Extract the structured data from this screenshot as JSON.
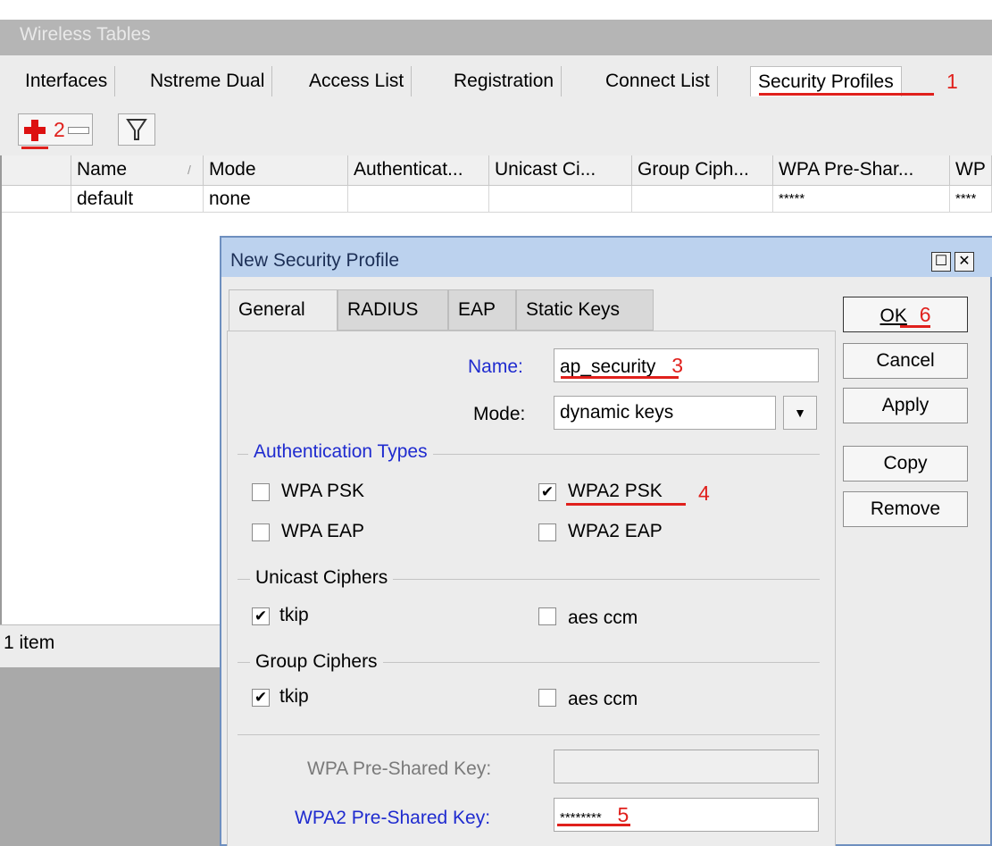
{
  "window": {
    "title": "Wireless Tables"
  },
  "tabs": [
    "Interfaces",
    "Nstreme Dual",
    "Access List",
    "Registration",
    "Connect List",
    "Security Profiles"
  ],
  "toolbar": {
    "add_icon": "plus-icon",
    "remove_icon": "minus-icon",
    "filter_icon": "filter-icon"
  },
  "table": {
    "columns": [
      "Name",
      "Mode",
      "Authenticat...",
      "Unicast Ci...",
      "Group Ciph...",
      "WPA Pre-Shar...",
      "WP"
    ],
    "sort_indicator": "/",
    "rows": [
      {
        "name": "default",
        "mode": "none",
        "auth": "",
        "unicast": "",
        "group": "",
        "wpa_key": "*****",
        "wpa2_key": "****"
      }
    ],
    "status": "1 item"
  },
  "dialog": {
    "title": "New Security Profile",
    "tabs": [
      "General",
      "RADIUS",
      "EAP",
      "Static Keys"
    ],
    "name_label": "Name:",
    "name_value": "ap_security",
    "mode_label": "Mode:",
    "mode_value": "dynamic keys",
    "auth_group": "Authentication Types",
    "auth": {
      "wpa_psk": "WPA PSK",
      "wpa2_psk": "WPA2 PSK",
      "wpa_eap": "WPA EAP",
      "wpa2_eap": "WPA2 EAP"
    },
    "auth_checked": {
      "wpa_psk": false,
      "wpa2_psk": true,
      "wpa_eap": false,
      "wpa2_eap": false
    },
    "unicast_group": "Unicast Ciphers",
    "group_group": "Group Ciphers",
    "cipher": {
      "tkip": "tkip",
      "aes": "aes ccm"
    },
    "unicast_checked": {
      "tkip": true,
      "aes": false
    },
    "group_checked": {
      "tkip": true,
      "aes": false
    },
    "wpa_key_label": "WPA Pre-Shared Key:",
    "wpa_key_value": "",
    "wpa2_key_label": "WPA2 Pre-Shared Key:",
    "wpa2_key_value": "********",
    "buttons": {
      "ok": "OK",
      "cancel": "Cancel",
      "apply": "Apply",
      "copy": "Copy",
      "remove": "Remove"
    },
    "check_mark": "✔"
  },
  "annotations": [
    "1",
    "2",
    "3",
    "4",
    "5",
    "6"
  ],
  "colors": {
    "annotation": "#e0201c",
    "blue_label": "#1f2bcf",
    "dialog_title_bg": "#bcd2ee"
  }
}
